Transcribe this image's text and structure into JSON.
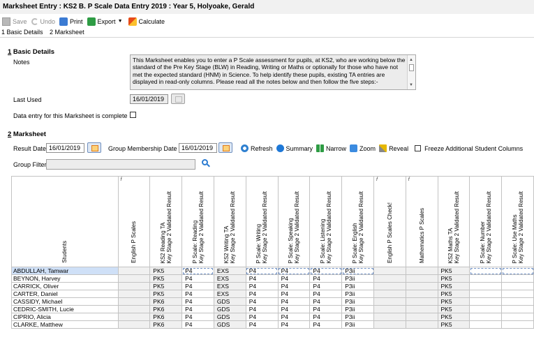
{
  "window": {
    "title": "Marksheet Entry : KS2 B. P Scale Data Entry 2019 : Year 5, Holyoake, Gerald"
  },
  "toolbar": {
    "save_label": "Save",
    "undo_label": "Undo",
    "print_label": "Print",
    "export_label": "Export",
    "calculate_label": "Calculate"
  },
  "nav": {
    "basic_details": "1 Basic Details",
    "marksheet": "2 Marksheet"
  },
  "basic_details": {
    "heading_num": "1",
    "heading_text": " Basic Details",
    "notes_label": "Notes",
    "notes_text": "This Marksheet enables you to enter a P Scale assessment for pupils, at KS2, who are working below the standard of the Pre Key Stage (BLW) in Reading, Writing or Maths or optionally for those who have not met the expected standard (HNM) in Science. To help identify these pupils, existing TA entries are displayed in read-only columns. Please read all the notes below and then follow the five steps:-",
    "last_used_label": "Last Used",
    "last_used_value": "16/01/2019",
    "complete_label": "Data entry for this Marksheet is complete",
    "complete_checked": false
  },
  "marksheet": {
    "heading_num": "2",
    "heading_text": " Marksheet",
    "result_date_label": "Result Date",
    "result_date_value": "16/01/2019",
    "group_membership_label": "Group Membership Date",
    "group_membership_value": "16/01/2019",
    "refresh_label": "Refresh",
    "summary_label": "Summary",
    "narrow_label": "Narrow",
    "zoom_label": "Zoom",
    "reveal_label": "Reveal",
    "freeze_label": "Freeze Additional Student Columns",
    "group_filter_label": "Group Filter",
    "group_filter_value": ""
  },
  "grid": {
    "students_header": "Students",
    "columns": [
      {
        "line1": "English P Scales",
        "line2": "",
        "fx": true
      },
      {
        "line1": "KS2 Reading TA",
        "line2": "Key Stage 2 Validated Result",
        "fx": false
      },
      {
        "line1": "P Scale: Reading",
        "line2": "Key Stage 2 Validated Result",
        "fx": false
      },
      {
        "line1": "KS2 Writing TA",
        "line2": "Key Stage 2 Validated Result",
        "fx": false
      },
      {
        "line1": "P Scale: Writing",
        "line2": "Key Stage 2 Validated Result",
        "fx": false
      },
      {
        "line1": "P Scale: Speaking",
        "line2": "Key Stage 2 Validated Result",
        "fx": false
      },
      {
        "line1": "P Scale: Listening",
        "line2": "Key Stage 2 Validated Result",
        "fx": false
      },
      {
        "line1": "P Scale: English",
        "line2": "Key Stage 2 Validated Result",
        "fx": false
      },
      {
        "line1": "English P Scales Check!",
        "line2": "",
        "fx": true
      },
      {
        "line1": "Mathematics P Scales",
        "line2": "",
        "fx": true
      },
      {
        "line1": "KS2 Maths TA",
        "line2": "Key Stage 2 Validated Result",
        "fx": false
      },
      {
        "line1": "P Scale: Number",
        "line2": "Key Stage 2 Validated Result",
        "fx": false
      },
      {
        "line1": "P Scale: Use Maths",
        "line2": "Key Stage 2 Validated Result",
        "fx": false
      }
    ],
    "rows": [
      {
        "name": "ABDULLAH, Tamwar",
        "cells": [
          "",
          "PK5",
          "P4",
          "EXS",
          "P4",
          "P4",
          "P4",
          "P3ii",
          "",
          "",
          "PK5",
          "",
          ""
        ]
      },
      {
        "name": "BEYNON, Harvey",
        "cells": [
          "",
          "PK5",
          "P4",
          "EXS",
          "P4",
          "P4",
          "P4",
          "P3ii",
          "",
          "",
          "PK5",
          "",
          ""
        ]
      },
      {
        "name": "CARRICK, Oliver",
        "cells": [
          "",
          "PK5",
          "P4",
          "EXS",
          "P4",
          "P4",
          "P4",
          "P3ii",
          "",
          "",
          "PK5",
          "",
          ""
        ]
      },
      {
        "name": "CARTER, Daniel",
        "cells": [
          "",
          "PK5",
          "P4",
          "EXS",
          "P4",
          "P4",
          "P4",
          "P3ii",
          "",
          "",
          "PK5",
          "",
          ""
        ]
      },
      {
        "name": "CASSIDY, Michael",
        "cells": [
          "",
          "PK6",
          "P4",
          "GDS",
          "P4",
          "P4",
          "P4",
          "P3ii",
          "",
          "",
          "PK5",
          "",
          ""
        ]
      },
      {
        "name": "CEDRIC-SMITH, Lucie",
        "cells": [
          "",
          "PK6",
          "P4",
          "GDS",
          "P4",
          "P4",
          "P4",
          "P3ii",
          "",
          "",
          "PK5",
          "",
          ""
        ]
      },
      {
        "name": "CIPRIO, Alicia",
        "cells": [
          "",
          "PK6",
          "P4",
          "GDS",
          "P4",
          "P4",
          "P4",
          "P3ii",
          "",
          "",
          "PK5",
          "",
          ""
        ]
      },
      {
        "name": "CLARKE, Matthew",
        "cells": [
          "",
          "PK6",
          "P4",
          "GDS",
          "P4",
          "P4",
          "P4",
          "P3ii",
          "",
          "",
          "PK5",
          "",
          ""
        ]
      }
    ]
  }
}
